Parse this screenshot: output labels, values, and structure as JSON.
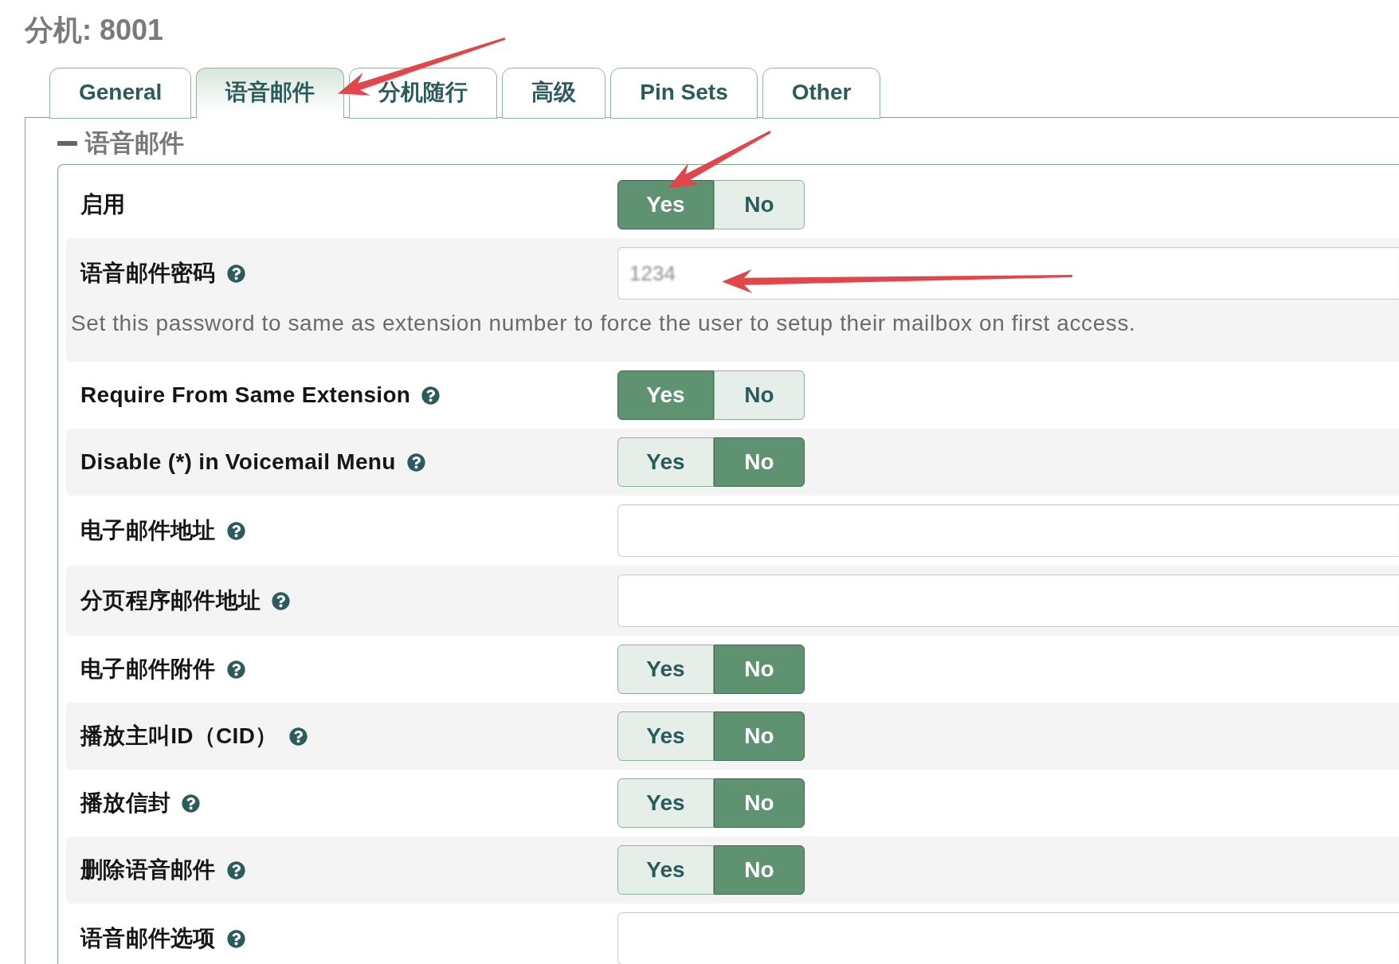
{
  "page_title": "分机: 8001",
  "tabs": [
    {
      "label": "General",
      "selected": false
    },
    {
      "label": "语音邮件",
      "selected": true
    },
    {
      "label": "分机随行",
      "selected": false
    },
    {
      "label": "高级",
      "selected": false
    },
    {
      "label": "Pin Sets",
      "selected": false
    },
    {
      "label": "Other",
      "selected": false
    }
  ],
  "section": {
    "title": "语音邮件",
    "expanded": true,
    "rows": [
      {
        "kind": "toggle",
        "label": "启用",
        "help": false,
        "options": [
          {
            "label": "Yes",
            "selected": true
          },
          {
            "label": "No",
            "selected": false
          }
        ]
      },
      {
        "kind": "password",
        "label": "语音邮件密码",
        "help": true,
        "value": "1234",
        "hint": "Set this password to same as extension number to force the user to setup their mailbox on first access."
      },
      {
        "kind": "toggle",
        "label": "Require From Same Extension",
        "help": true,
        "options": [
          {
            "label": "Yes",
            "selected": true
          },
          {
            "label": "No",
            "selected": false
          }
        ]
      },
      {
        "kind": "toggle",
        "label": "Disable (*) in Voicemail Menu",
        "help": true,
        "options": [
          {
            "label": "Yes",
            "selected": false
          },
          {
            "label": "No",
            "selected": true
          }
        ]
      },
      {
        "kind": "text",
        "label": "电子邮件地址",
        "help": true
      },
      {
        "kind": "text",
        "label": "分页程序邮件地址",
        "help": true
      },
      {
        "kind": "toggle",
        "label": "电子邮件附件",
        "help": true,
        "options": [
          {
            "label": "Yes",
            "selected": false
          },
          {
            "label": "No",
            "selected": true
          }
        ]
      },
      {
        "kind": "toggle",
        "label": "播放主叫ID（CID）",
        "help": true,
        "options": [
          {
            "label": "Yes",
            "selected": false
          },
          {
            "label": "No",
            "selected": true
          }
        ]
      },
      {
        "kind": "toggle",
        "label": "播放信封",
        "help": true,
        "options": [
          {
            "label": "Yes",
            "selected": false
          },
          {
            "label": "No",
            "selected": true
          }
        ]
      },
      {
        "kind": "toggle",
        "label": "删除语音邮件",
        "help": true,
        "options": [
          {
            "label": "Yes",
            "selected": false
          },
          {
            "label": "No",
            "selected": true
          }
        ]
      },
      {
        "kind": "text",
        "label": "语音邮件选项",
        "help": true
      }
    ]
  }
}
